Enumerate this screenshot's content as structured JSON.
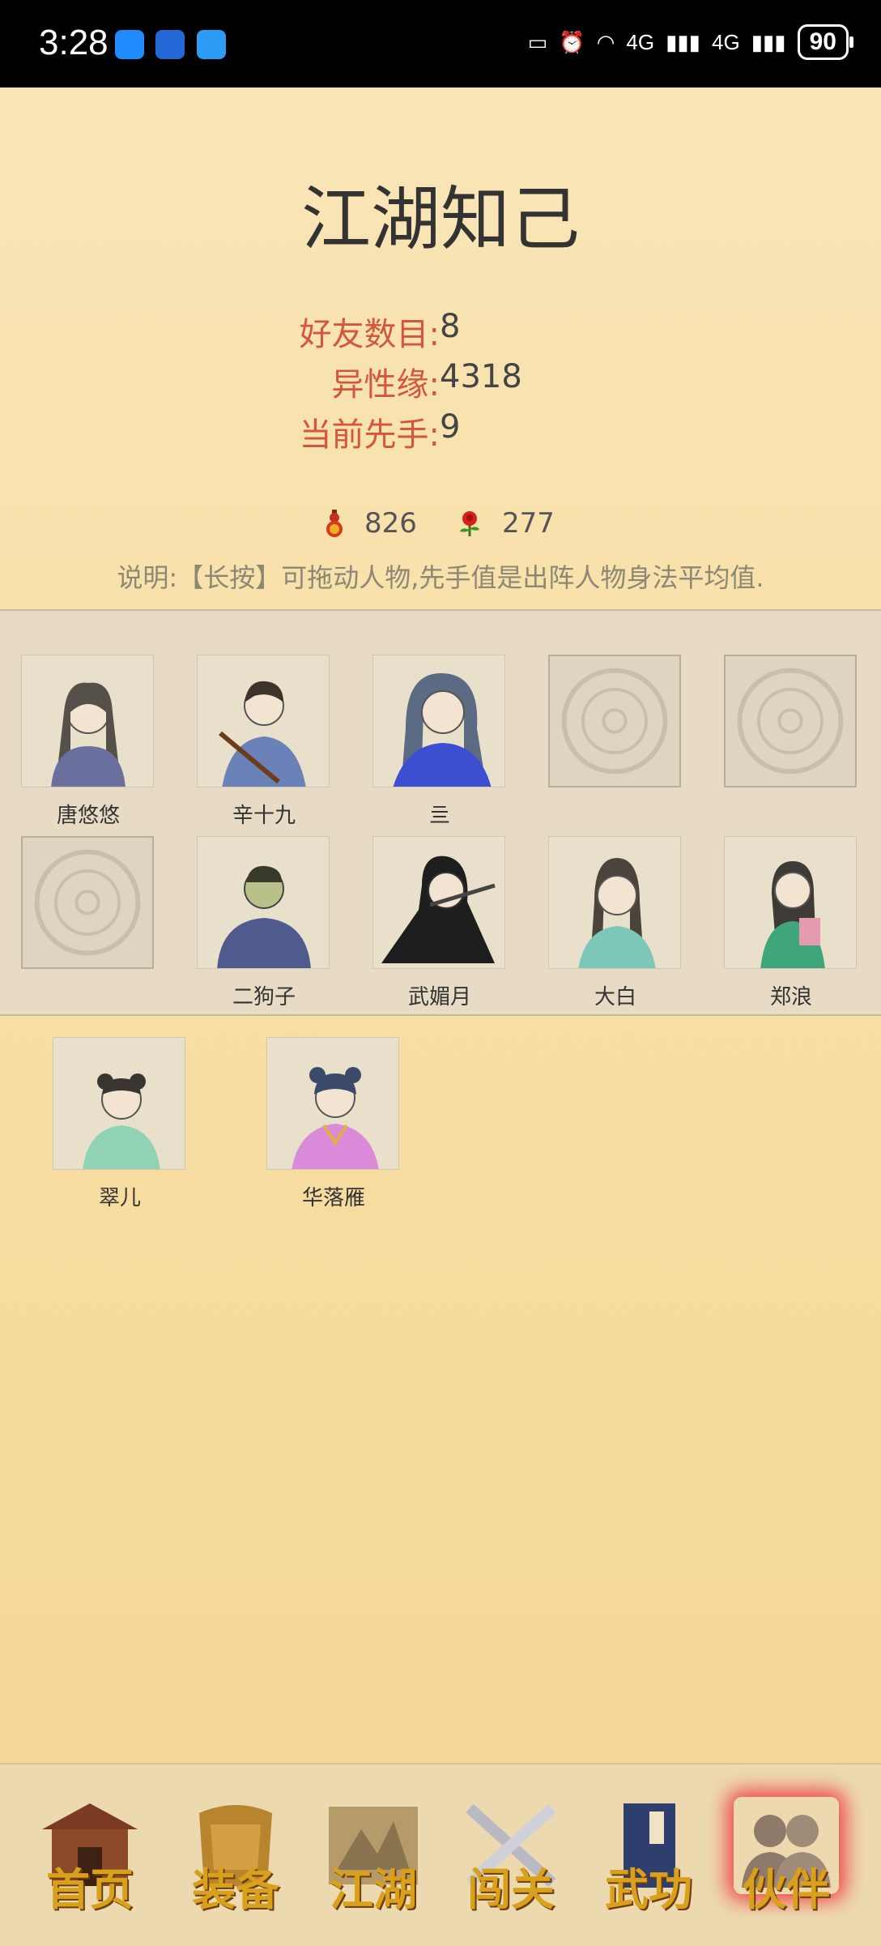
{
  "status_bar": {
    "time": "3:28",
    "battery": "90",
    "network1": "4G",
    "network2": "4G"
  },
  "page": {
    "title": "江湖知己"
  },
  "stats": [
    {
      "label": "好友数目:",
      "value": "8"
    },
    {
      "label": "异性缘:",
      "value": "4318"
    },
    {
      "label": "当前先手:",
      "value": "9"
    }
  ],
  "resources": {
    "gourd_count": "826",
    "rose_count": "277"
  },
  "hint": "说明:【长按】可拖动人物,先手值是出阵人物身法平均值.",
  "team_slots": [
    {
      "name": "唐悠悠",
      "empty": false,
      "color": "#6a6f9e"
    },
    {
      "name": "辛十九",
      "empty": false,
      "color": "#6a82b8"
    },
    {
      "name": "亖",
      "empty": false,
      "color": "#3b4fd0"
    },
    {
      "name": "",
      "empty": true
    },
    {
      "name": "",
      "empty": true
    },
    {
      "name": "",
      "empty": true
    },
    {
      "name": "二狗子",
      "empty": false,
      "color": "#4f5a8e"
    },
    {
      "name": "武媚月",
      "empty": false,
      "color": "#2a2a2a"
    },
    {
      "name": "大白",
      "empty": false,
      "color": "#7cc7b8"
    },
    {
      "name": "郑浪",
      "empty": false,
      "color": "#3fa57a"
    }
  ],
  "reserve": [
    {
      "name": "翠儿",
      "color": "#8fd3b4"
    },
    {
      "name": "华落雁",
      "color": "#d98ad9"
    }
  ],
  "nav": [
    {
      "label": "首页",
      "icon": "house-icon",
      "active": false
    },
    {
      "label": "装备",
      "icon": "armor-icon",
      "active": false
    },
    {
      "label": "江湖",
      "icon": "scroll-map-icon",
      "active": false
    },
    {
      "label": "闯关",
      "icon": "crossed-swords-icon",
      "active": false
    },
    {
      "label": "武功",
      "icon": "book-icon",
      "active": false
    },
    {
      "label": "伙伴",
      "icon": "partners-icon",
      "active": true
    }
  ]
}
